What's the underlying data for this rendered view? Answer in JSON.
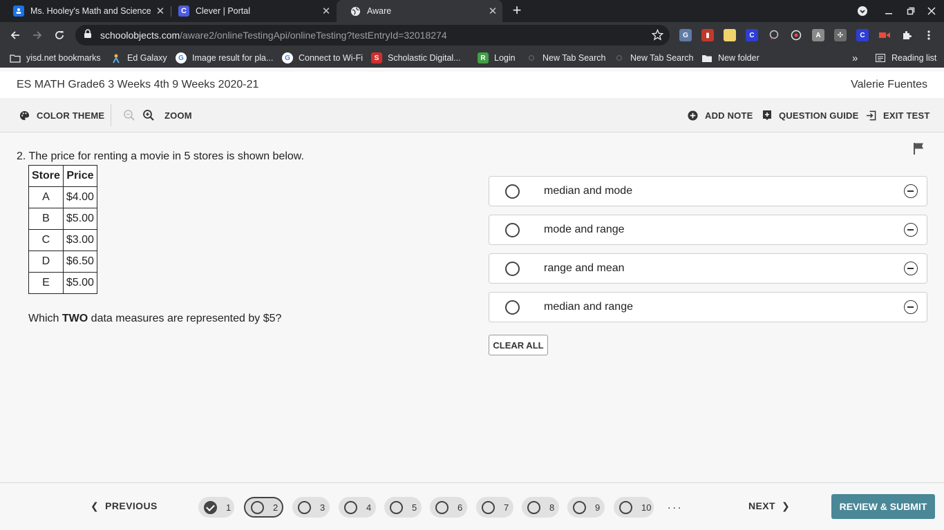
{
  "browser": {
    "tabs": [
      {
        "title": "Ms. Hooley's Math and Science F",
        "favicon": "classroom-icon",
        "color": "#1a73e8"
      },
      {
        "title": "Clever | Portal",
        "favicon": "clever-icon",
        "color": "#4e5ce2"
      },
      {
        "title": "Aware",
        "favicon": "globe-icon",
        "color": "#e8eaed"
      }
    ],
    "url_host": "schoolobjects.com",
    "url_path": "/aware2/onlineTestingApi/onlineTesting?testEntryId=32018274",
    "bookmarks": [
      {
        "label": "yisd.net bookmarks",
        "icon": "folder-icon"
      },
      {
        "label": "Ed Galaxy",
        "icon": "edgalaxy-icon"
      },
      {
        "label": "Image result for pla...",
        "icon": "google-icon"
      },
      {
        "label": "Connect to Wi-Fi",
        "icon": "google-icon"
      },
      {
        "label": "Scholastic Digital...",
        "icon": "scholastic-icon"
      },
      {
        "label": "Login",
        "icon": "login-icon"
      },
      {
        "label": "New Tab Search",
        "icon": "search-icon"
      },
      {
        "label": "New Tab Search",
        "icon": "search-icon"
      },
      {
        "label": "New folder",
        "icon": "folder-icon"
      }
    ],
    "overflow": "»",
    "reading_list": "Reading list"
  },
  "app": {
    "test_title": "ES MATH Grade6 3 Weeks 4th 9 Weeks 2020-21",
    "user_name": "Valerie Fuentes",
    "toolbar": {
      "color_theme": "COLOR THEME",
      "zoom": "ZOOM",
      "add_note": "ADD NOTE",
      "question_guide": "QUESTION GUIDE",
      "exit_test": "EXIT TEST"
    }
  },
  "question": {
    "prompt": "2. The price for renting a movie in 5 stores is shown below.",
    "table": {
      "headers": [
        "Store",
        "Price"
      ],
      "rows": [
        [
          "A",
          "$4.00"
        ],
        [
          "B",
          "$5.00"
        ],
        [
          "C",
          "$3.00"
        ],
        [
          "D",
          "$6.50"
        ],
        [
          "E",
          "$5.00"
        ]
      ]
    },
    "sub_prefix": "Which ",
    "sub_bold": "TWO",
    "sub_suffix": " data measures are represented by $5?",
    "choices": [
      "median and mode",
      "mode and range",
      "range and mean",
      "median and range"
    ],
    "clear_all": "CLEAR ALL"
  },
  "footer": {
    "previous": "PREVIOUS",
    "next": "NEXT",
    "review_submit": "REVIEW & SUBMIT",
    "ellipsis": "...",
    "questions": [
      {
        "num": "1",
        "state": "answered"
      },
      {
        "num": "2",
        "state": "current"
      },
      {
        "num": "3",
        "state": "open"
      },
      {
        "num": "4",
        "state": "open"
      },
      {
        "num": "5",
        "state": "open"
      },
      {
        "num": "6",
        "state": "open"
      },
      {
        "num": "7",
        "state": "open"
      },
      {
        "num": "8",
        "state": "open"
      },
      {
        "num": "9",
        "state": "open"
      },
      {
        "num": "10",
        "state": "open"
      }
    ]
  },
  "colors": {
    "accent": "#4a8797",
    "chrome_dark": "#202124",
    "chrome_toolbar": "#35363a"
  }
}
